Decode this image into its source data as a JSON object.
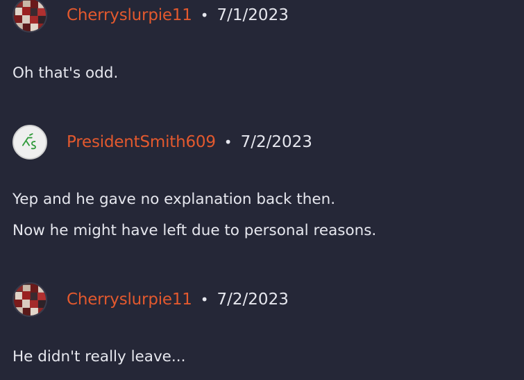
{
  "comments": [
    {
      "username": "Cherryslurpie11",
      "separator": "•",
      "date": "7/1/2023",
      "avatar_icon": "collage-avatar-icon",
      "lines": [
        "Oh that's odd."
      ]
    },
    {
      "username": "PresidentSmith609",
      "separator": "•",
      "date": "7/2/2023",
      "avatar_icon": "signature-avatar-icon",
      "lines": [
        "Yep and he gave no explanation back then.",
        "Now he might have left due to personal reasons."
      ]
    },
    {
      "username": "Cherryslurpie11",
      "separator": "•",
      "date": "7/2/2023",
      "avatar_icon": "collage-avatar-icon",
      "lines": [
        "He didn't really leave..."
      ]
    }
  ],
  "colors": {
    "background": "#252737",
    "username": "#e3592e",
    "text": "#e6e7ee"
  }
}
